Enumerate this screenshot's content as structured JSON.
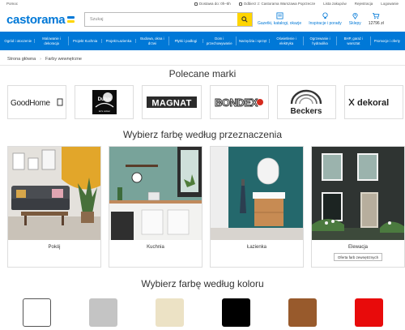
{
  "topbar": {
    "help": "Pomoc",
    "delivery": "Dostawa do: 0h–5h",
    "store": "Odbierz z: Castorama Warszawa Poprzecze",
    "wishlist": "Lista zakupów",
    "register": "Rejestracja",
    "login": "Logowanie"
  },
  "header": {
    "logo": "castorama",
    "search_placeholder": "Szukaj",
    "items": [
      {
        "label": "Gazetki, katalogi, okazje",
        "icon": "newspaper-icon"
      },
      {
        "label": "Inspiracje i porady",
        "icon": "lightbulb-icon"
      },
      {
        "label": "Sklepy",
        "icon": "map-pin-icon"
      }
    ],
    "cart": {
      "count": "0",
      "price": "12796 zł"
    }
  },
  "nav": [
    "Ogród i otoczenie",
    "Malowanie i dekoracja",
    "Projekt Kuchnia",
    "Projekt Łazienka",
    "Budowa, okna i drzwi",
    "Płytki i podłogi",
    "Dom i przechowywanie",
    "Narzędzia i sprzęt",
    "Oświetlenie i elektryka",
    "Ogrzewanie i hydraulika",
    "BHP, garaż i warsztat",
    "Promocje i oferty"
  ],
  "breadcrumb": {
    "home": "Strona główna",
    "current": "Farby wewnętrzne"
  },
  "brands_section": {
    "title": "Polecane marki",
    "brands": [
      "GoodHome",
      "Dulux",
      "MAGNAT",
      "BONDEX",
      "Beckers",
      "dekoral"
    ],
    "dulux_tagline": "let's colour"
  },
  "purpose_section": {
    "title": "Wybierz farbę według przeznaczenia",
    "cards": [
      {
        "label": "Pokój",
        "sub": ""
      },
      {
        "label": "Kuchnia",
        "sub": ""
      },
      {
        "label": "Łazienka",
        "sub": ""
      },
      {
        "label": "Elewacja",
        "sub": "Oferta farb zewnętrznych"
      }
    ]
  },
  "color_section": {
    "title": "Wybierz farbę według koloru",
    "swatches": [
      {
        "name": "white",
        "hex": "#ffffff"
      },
      {
        "name": "grey",
        "hex": "#c4c4c4"
      },
      {
        "name": "beige",
        "hex": "#ece2c5"
      },
      {
        "name": "black",
        "hex": "#000000"
      },
      {
        "name": "brown",
        "hex": "#985a2c"
      },
      {
        "name": "red",
        "hex": "#e80b0b"
      }
    ]
  },
  "colors": {
    "brand_blue": "#0078d7",
    "brand_yellow": "#ffd500"
  }
}
